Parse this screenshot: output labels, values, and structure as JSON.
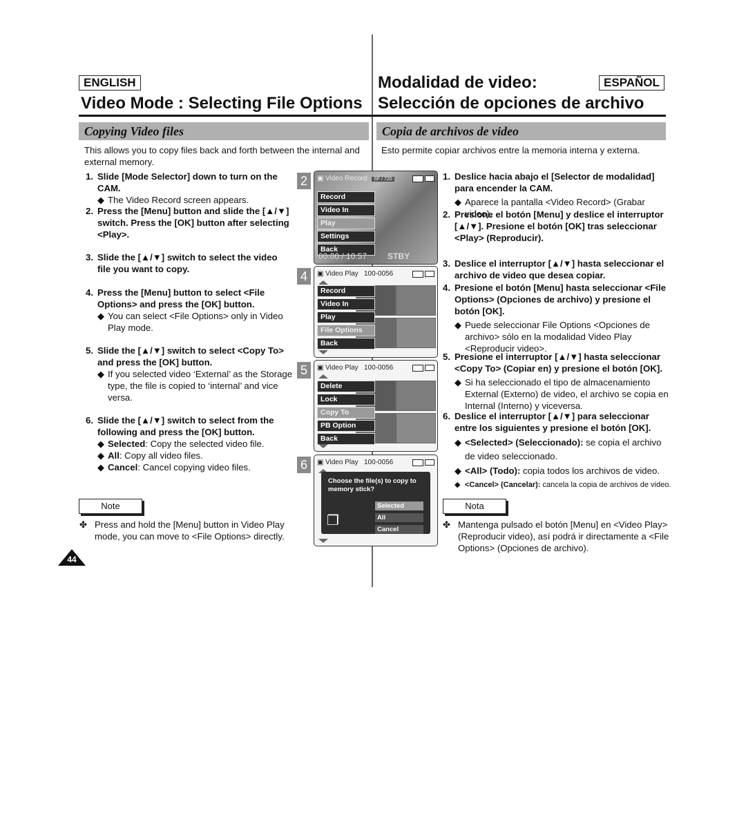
{
  "english": {
    "lang_badge": "ENGLISH",
    "title": "Video Mode : Selecting File Options",
    "section": "Copying Video files",
    "intro": "This allows you to copy files back and forth between the internal and external memory.",
    "steps": [
      {
        "num": "1.",
        "bold": "Slide [Mode Selector] down to turn on the CAM.",
        "bullets": [
          "The Video Record screen appears."
        ]
      },
      {
        "num": "2.",
        "bold": "Press the [Menu] button and slide the [▲/▼] switch. Press the [OK] button after selecting <Play>.",
        "bullets": []
      },
      {
        "num": "3.",
        "bold": "Slide the [▲/▼] switch to select the video file you want to copy.",
        "bullets": []
      },
      {
        "num": "4.",
        "bold": "Press the [Menu] button to select <File Options> and press the [OK] button.",
        "bullets": [
          "You can select <File Options> only in Video Play mode."
        ]
      },
      {
        "num": "5.",
        "bold": "Slide the [▲/▼] switch to select <Copy To> and press the [OK] button.",
        "bullets": [
          "If you selected video ‘External’ as the Storage type, the file is copied to ‘internal’ and vice versa."
        ]
      },
      {
        "num": "6.",
        "bold": "Slide the [▲/▼] switch to select from the following and press the [OK] button.",
        "bullets": [
          {
            "term": "Selected",
            "text": ": Copy the selected video file."
          },
          {
            "term": "All",
            "text": ": Copy all video files."
          },
          {
            "term": "Cancel",
            "text": ": Cancel copying video files."
          }
        ]
      }
    ],
    "note_label": "Note",
    "note_text": "Press and hold the [Menu] button in Video Play mode, you can move to <File Options> directly.",
    "page_number": "44"
  },
  "espanol": {
    "lang_badge": "ESPAÑOL",
    "title_line1": "Modalidad de video:",
    "title_line2": "Selección de opciones de archivo",
    "section": "Copia de archivos de video",
    "intro": "Esto permite copiar archivos entre la memoria interna y externa.",
    "steps": [
      {
        "num": "1.",
        "bold": "Deslice hacia abajo el [Selector de modalidad] para encender la CAM.",
        "bullets": [
          "Aparece la pantalla <Video Record> (Grabar video)."
        ]
      },
      {
        "num": "2.",
        "bold": "Presione el botón [Menu] y deslice el interruptor [▲/▼]. Presione el botón [OK] tras seleccionar <Play> (Reproducir).",
        "bullets": []
      },
      {
        "num": "3.",
        "bold": "Deslice el interruptor [▲/▼] hasta seleccionar el archivo de video que desea copiar.",
        "bullets": []
      },
      {
        "num": "4.",
        "bold": "Presione el botón [Menu] hasta seleccionar <File Options> (Opciones de archivo) y presione el botón [OK].",
        "bullets": [
          "Puede seleccionar File Options <Opciones de archivo> sólo en la modalidad Video Play <Reproducir video>."
        ]
      },
      {
        "num": "5.",
        "bold": "Presione el interruptor [▲/▼] hasta seleccionar <Copy To> (Copiar en) y presione el botón [OK].",
        "bullets": [
          "Si ha seleccionado el tipo de almacenamiento External (Externo) de video, el archivo se copia en Internal (Interno) y viceversa."
        ]
      },
      {
        "num": "6.",
        "bold": "Deslice el interruptor [▲/▼] para seleccionar entre los siguientes y presione el botón [OK].",
        "bullets": [
          {
            "term": "<Selected> (Seleccionado):",
            "text": " se copia el archivo de video seleccionado."
          },
          {
            "term": "<All> (Todo):",
            "text": " copia todos los archivos de video."
          },
          {
            "term": "<Cancel> (Cancelar):",
            "text": " cancela la copia de archivos de video."
          }
        ]
      }
    ],
    "note_label": "Nota",
    "note_text": "Mantenga pulsado el botón [Menu] en <Video Play> (Reproducir video), así podrá ir directamente a <File Options> (Opciones de archivo)."
  },
  "screens": [
    {
      "tag": "2",
      "header": "Video Record",
      "quality": "SF / 720",
      "menu": [
        "Record",
        "Video In",
        "Play",
        "Settings",
        "Back"
      ],
      "selected": "Play",
      "timecode": "00:00 / 10:57",
      "status": "STBY"
    },
    {
      "tag": "4",
      "header": "Video Play",
      "file_number": "100-0056",
      "menu": [
        "Record",
        "Video In",
        "Play",
        "File Options",
        "Back"
      ],
      "selected": "File Options"
    },
    {
      "tag": "5",
      "header": "Video Play",
      "file_number": "100-0056",
      "menu": [
        "Delete",
        "Lock",
        "Copy To",
        "PB Option",
        "Back"
      ],
      "selected": "Copy To"
    },
    {
      "tag": "6",
      "header": "Video Play",
      "file_number": "100-0056",
      "dialog_text": "Choose the file(s) to copy to memory stick?",
      "options": [
        "Selected",
        "All",
        "Cancel"
      ],
      "selected": "Selected"
    }
  ],
  "symbols": {
    "bullet": "◆",
    "note_bullet": "✤",
    "camera_icon": "🎥",
    "copy_icon": "❐"
  }
}
